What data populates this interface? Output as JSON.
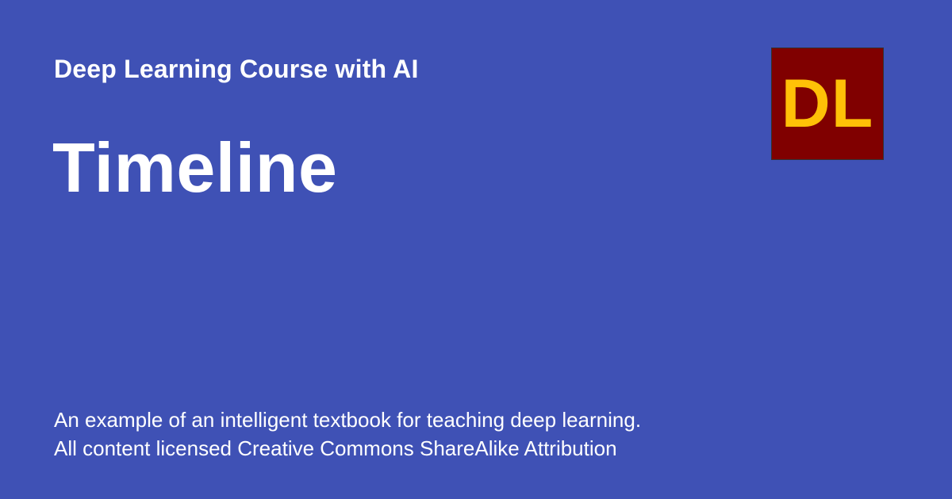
{
  "colors": {
    "background": "#3f51b5",
    "text": "#ffffff",
    "logo_background": "#800000",
    "logo_text": "#ffc107"
  },
  "site_name": "Deep Learning Course with AI",
  "page_title": "Timeline",
  "logo": {
    "text": "DL",
    "icon": "dl-logo-icon"
  },
  "description": {
    "line1": "An example of an intelligent textbook for teaching deep learning.",
    "line2": "All content licensed Creative Commons ShareAlike Attribution"
  }
}
